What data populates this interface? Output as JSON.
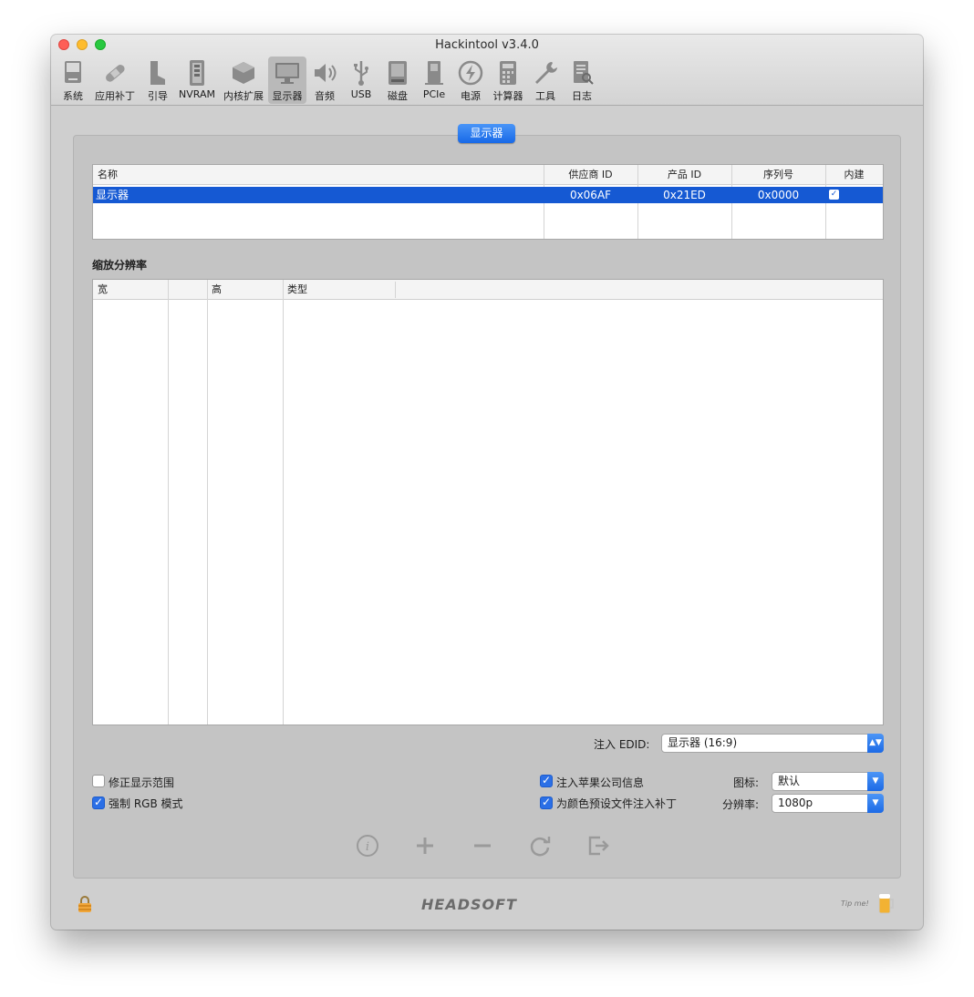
{
  "window": {
    "title": "Hackintool v3.4.0"
  },
  "toolbar": {
    "items": [
      {
        "label": "系统",
        "icon": "system-icon"
      },
      {
        "label": "应用补丁",
        "icon": "patch-icon"
      },
      {
        "label": "引导",
        "icon": "boot-icon"
      },
      {
        "label": "NVRAM",
        "icon": "nvram-icon"
      },
      {
        "label": "内核扩展",
        "icon": "kext-icon"
      },
      {
        "label": "显示器",
        "icon": "display-icon",
        "selected": true
      },
      {
        "label": "音频",
        "icon": "audio-icon"
      },
      {
        "label": "USB",
        "icon": "usb-icon"
      },
      {
        "label": "磁盘",
        "icon": "disk-icon"
      },
      {
        "label": "PCIe",
        "icon": "pcie-icon"
      },
      {
        "label": "电源",
        "icon": "power-icon"
      },
      {
        "label": "计算器",
        "icon": "calculator-icon"
      },
      {
        "label": "工具",
        "icon": "tools-icon"
      },
      {
        "label": "日志",
        "icon": "log-icon"
      }
    ]
  },
  "section_tab": "显示器",
  "display_table": {
    "headers": [
      "名称",
      "供应商 ID",
      "产品 ID",
      "序列号",
      "内建"
    ],
    "rows": [
      {
        "name": "显示器",
        "vendor_id": "0x06AF",
        "product_id": "0x21ED",
        "serial": "0x0000",
        "builtin": true
      }
    ]
  },
  "scaled_section": {
    "title": "缩放分辨率"
  },
  "resolution_table": {
    "headers": [
      "宽",
      "高",
      "类型"
    ]
  },
  "inject_edid": {
    "label": "注入 EDID:",
    "value": "显示器 (16:9)"
  },
  "options": {
    "fix_display_range": {
      "label": "修正显示范围",
      "checked": false
    },
    "force_rgb": {
      "label": "强制 RGB 模式",
      "checked": true
    },
    "inject_apple_info": {
      "label": "注入苹果公司信息",
      "checked": true
    },
    "patch_color_profile": {
      "label": "为颜色预设文件注入补丁",
      "checked": true
    }
  },
  "icon_field": {
    "label": "图标:",
    "value": "默认"
  },
  "resolution_field": {
    "label": "分辨率:",
    "value": "1080p"
  },
  "actions": [
    "info-icon",
    "plus-icon",
    "minus-icon",
    "refresh-icon",
    "export-icon"
  ],
  "footer": {
    "brand": "HEADSOFT",
    "tip": "Tip me!"
  },
  "colors": {
    "accent": "#1559d3",
    "button_blue": "#2b6fe6"
  }
}
